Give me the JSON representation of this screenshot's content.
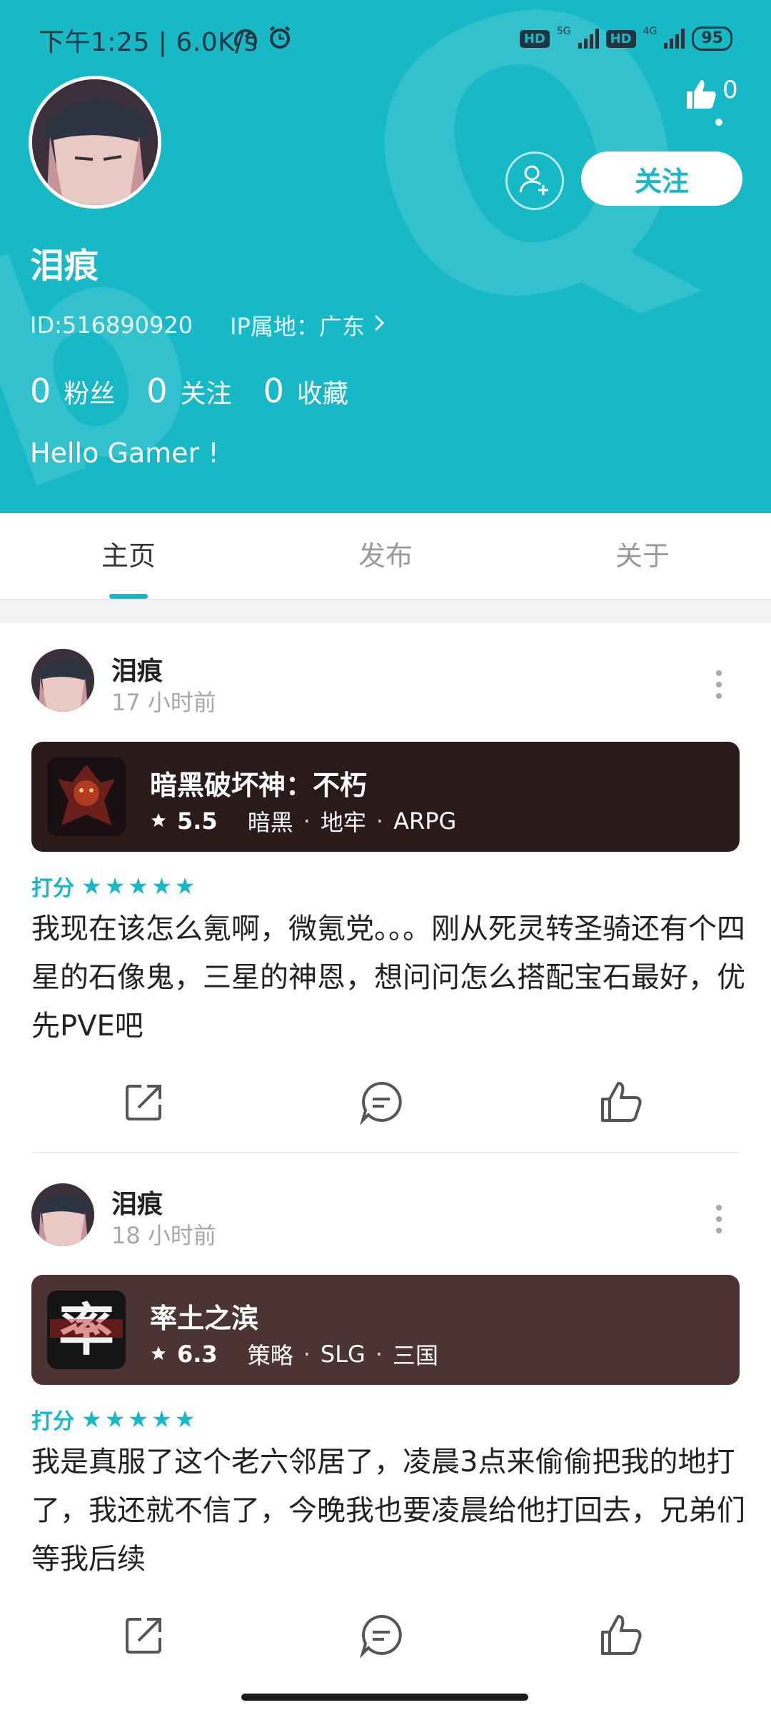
{
  "status_bar": {
    "time_speed": "下午1:25 | 6.0K/s",
    "hd1": "HD",
    "net1": "5G",
    "hd2": "HD",
    "net2": "4G",
    "battery": "95"
  },
  "profile": {
    "username": "泪痕",
    "id": "ID:516890920",
    "ip_location": "IP属地：广东",
    "likes_count": "0",
    "follow_label": "关注",
    "stats": [
      {
        "num": "0",
        "label": "粉丝"
      },
      {
        "num": "0",
        "label": "关注"
      },
      {
        "num": "0",
        "label": "收藏"
      }
    ],
    "bio": "Hello Gamer !"
  },
  "tabs": [
    {
      "label": "主页",
      "active": true
    },
    {
      "label": "发布",
      "active": false
    },
    {
      "label": "关于",
      "active": false
    }
  ],
  "posts": [
    {
      "author": "泪痕",
      "time": "17 小时前",
      "game": {
        "title": "暗黑破坏神：不朽",
        "score": "5.5",
        "tags": [
          "暗黑",
          "地牢",
          "ARPG"
        ],
        "card_color": "#2a1a1c"
      },
      "rating_label": "打分",
      "rating_stars": 5,
      "body": "我现在该怎么氪啊，微氪党。。。刚从死灵转圣骑还有个四星的石像鬼，三星的神恩，想问问怎么搭配宝石最好，优先PVE吧"
    },
    {
      "author": "泪痕",
      "time": "18 小时前",
      "game": {
        "title": "率土之滨",
        "score": "6.3",
        "tags": [
          "策略",
          "SLG",
          "三国"
        ],
        "card_color": "#4d3434"
      },
      "rating_label": "打分",
      "rating_stars": 5,
      "body": "我是真服了这个老六邻居了，凌晨3点来偷偷把我的地打了，我还就不信了，今晚我也要凌晨给他打回去，兄弟们等我后续"
    }
  ],
  "colors": {
    "accent": "#17b9c7",
    "header_bg": "#17b9c7"
  }
}
